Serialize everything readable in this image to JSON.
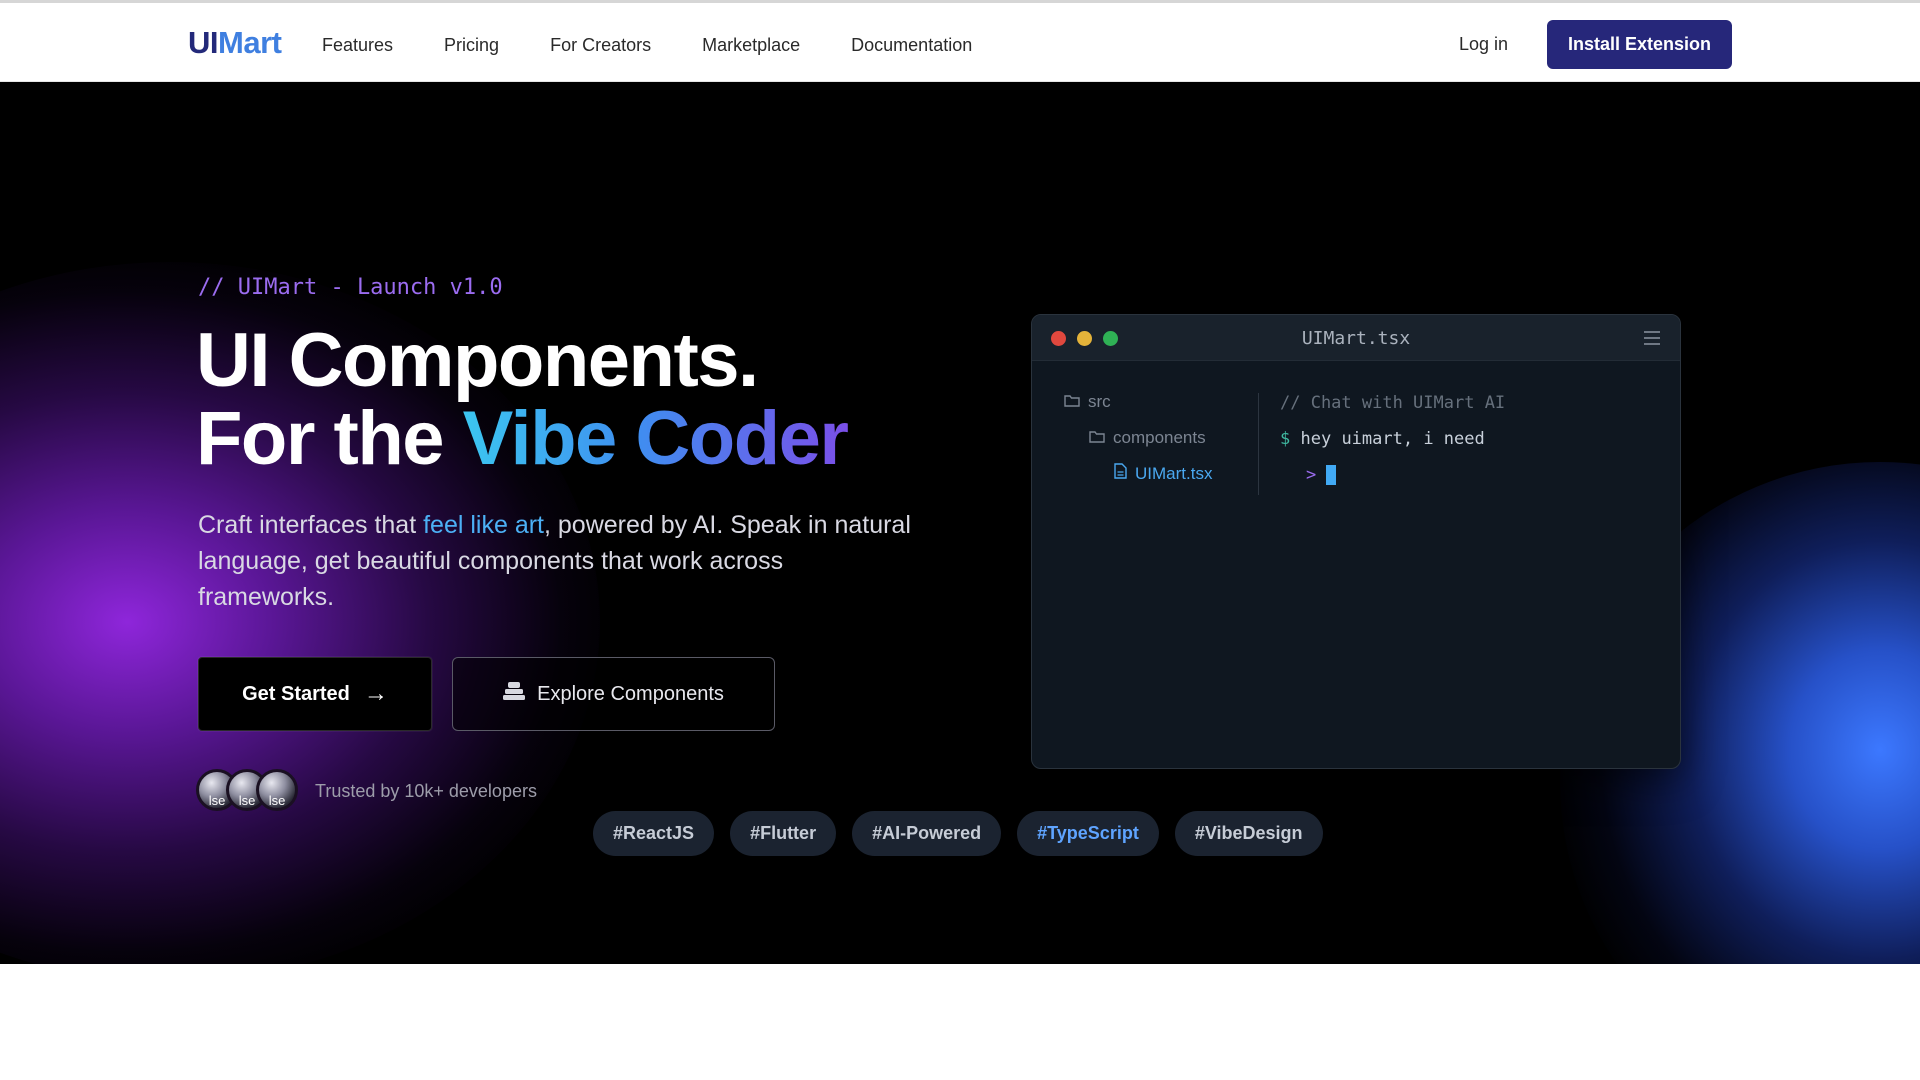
{
  "nav": {
    "logo_ui": "UI",
    "logo_mart": "Mart",
    "links": [
      "Features",
      "Pricing",
      "For Creators",
      "Marketplace",
      "Documentation"
    ],
    "login": "Log in",
    "install": "Install Extension"
  },
  "hero": {
    "eyebrow": "// UIMart - Launch v1.0",
    "title_line1": "UI Components.",
    "title_line2_plain": "For the",
    "title_line2_highlight": "Vibe Coder",
    "sub_before": "Craft interfaces that ",
    "sub_highlight": "feel like art",
    "sub_after": ", powered by AI. Speak in natural language, get beautiful components that work across frameworks.",
    "cta_primary": "Get Started",
    "cta_primary_arrow": "→",
    "cta_secondary": "Explore Components",
    "avatar_text": "lse",
    "trusted": "Trusted by 10k+ developers"
  },
  "editor": {
    "title": "UIMart.tsx",
    "dots": [
      "#e0483e",
      "#e4b33a",
      "#2fb155"
    ],
    "tree": [
      "src",
      "components",
      "UIMart.tsx"
    ],
    "comment": "// Chat with UIMart AI",
    "prompt_symbol": "$",
    "prompt_text": "hey uimart, i need",
    "arrow": ">"
  },
  "tags": [
    "#ReactJS",
    "#Flutter",
    "#AI-Powered",
    "#TypeScript",
    "#VibeDesign"
  ],
  "colors": {
    "brand_dark": "#26277a",
    "brand_light": "#3f7fe0",
    "purple_glow": "#9628e6",
    "blue_glow": "#3c78ff"
  }
}
